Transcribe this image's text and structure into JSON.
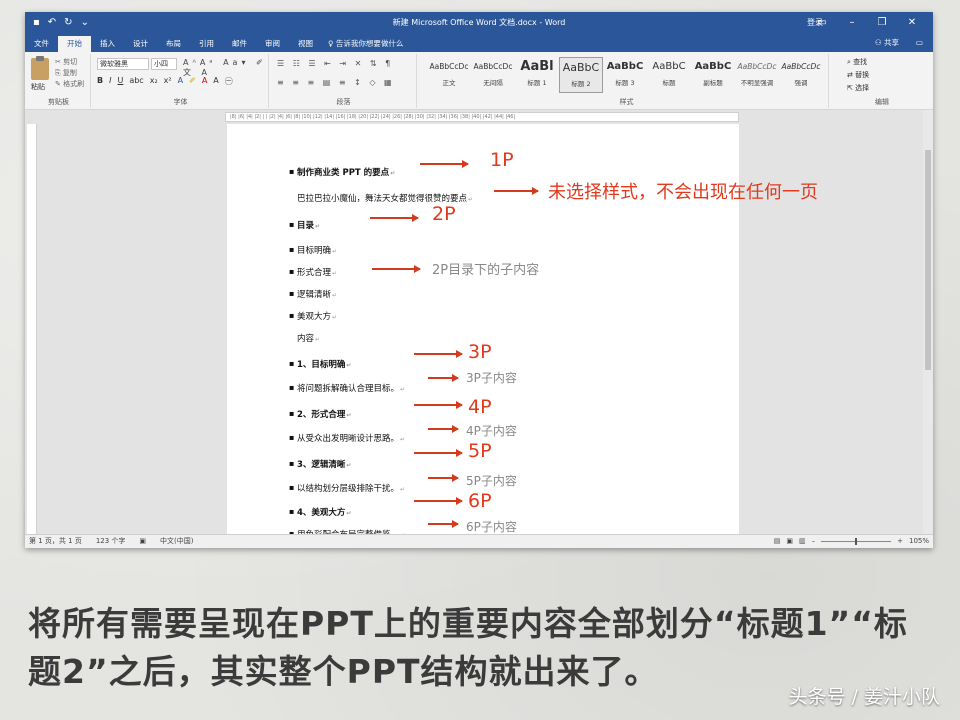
{
  "window": {
    "title": "新建 Microsoft Office Word 文档.docx - Word",
    "login": "登录",
    "quick_access": {
      "undo": "↶",
      "redo": "↻",
      "more": "⌄"
    }
  },
  "tabs": [
    "文件",
    "开始",
    "插入",
    "设计",
    "布局",
    "引用",
    "邮件",
    "审阅",
    "视图"
  ],
  "active_tab": "开始",
  "tell_me": "告诉我你想要做什么",
  "share": "共享",
  "ribbon": {
    "clipboard": {
      "paste": "粘贴",
      "cut": "剪切",
      "copy": "复制",
      "painter": "格式刷",
      "label": "剪贴板"
    },
    "font": {
      "name": "微软雅黑",
      "size": "小四",
      "label": "字体"
    },
    "paragraph": {
      "label": "段落"
    },
    "styles": {
      "label": "样式",
      "items": [
        {
          "sample": "AaBbCcDc",
          "name": "正文"
        },
        {
          "sample": "AaBbCcDc",
          "name": "无间隔"
        },
        {
          "sample": "AaBl",
          "name": "标题 1"
        },
        {
          "sample": "AaBbC",
          "name": "标题 2"
        },
        {
          "sample": "AaBbC",
          "name": "标题 3"
        },
        {
          "sample": "AaBbC",
          "name": "标题"
        },
        {
          "sample": "AaBbC",
          "name": "副标题"
        },
        {
          "sample": "AaBbCcDc",
          "name": "不明显强调"
        },
        {
          "sample": "AaBbCcDc",
          "name": "强调"
        }
      ]
    },
    "editing": {
      "find": "查找",
      "replace": "替换",
      "select": "选择",
      "label": "编辑"
    }
  },
  "document": {
    "lines": [
      {
        "text": "制作商业类 PPT 的要点",
        "bold": true,
        "bullet": true
      },
      {
        "text": "巴拉巴拉小魔仙，舞法天女都觉得很赞的要点",
        "bold": false,
        "bullet": false
      },
      {
        "text": "目录",
        "bold": true,
        "bullet": true
      },
      {
        "text": "目标明确",
        "bold": false,
        "bullet": true
      },
      {
        "text": "形式合理",
        "bold": false,
        "bullet": true
      },
      {
        "text": "逻辑清晰",
        "bold": false,
        "bullet": true
      },
      {
        "text": "美观大方",
        "bold": false,
        "bullet": true
      },
      {
        "text": "内容",
        "bold": false,
        "bullet": false
      },
      {
        "text": "1、目标明确",
        "bold": true,
        "bullet": true
      },
      {
        "text": "将问题拆解确认合理目标。",
        "bold": false,
        "bullet": true
      },
      {
        "text": "2、形式合理",
        "bold": true,
        "bullet": true
      },
      {
        "text": "从受众出发明晰设计思路。",
        "bold": false,
        "bullet": true
      },
      {
        "text": "3、逻辑清晰",
        "bold": true,
        "bullet": true
      },
      {
        "text": "以结构划分层级排除干扰。",
        "bold": false,
        "bullet": true
      },
      {
        "text": "4、美观大方",
        "bold": true,
        "bullet": true
      },
      {
        "text": "用色彩配合布局完整借鉴。",
        "bold": false,
        "bullet": true
      }
    ]
  },
  "annotations": {
    "p1": "1P",
    "note_unstyled": "未选择样式，不会出现在任何一页",
    "p2": "2P",
    "p2_sub": "2P目录下的子内容",
    "p3": "3P",
    "p3_sub": "3P子内容",
    "p4": "4P",
    "p4_sub": "4P子内容",
    "p5": "5P",
    "p5_sub": "5P子内容",
    "p6": "6P",
    "p6_sub": "6P子内容"
  },
  "statusbar": {
    "page": "第 1 页，共 1 页",
    "words": "123 个字",
    "language": "中文(中国)",
    "zoom": "105%"
  },
  "caption": "将所有需要呈现在PPT上的重要内容全部划分“标题1”“标题2”之后，其实整个PPT结构就出来了。",
  "watermark": "头条号 / 姜汁小队",
  "colors": {
    "word_blue": "#2b579a",
    "annotation_red": "#e2381c"
  }
}
